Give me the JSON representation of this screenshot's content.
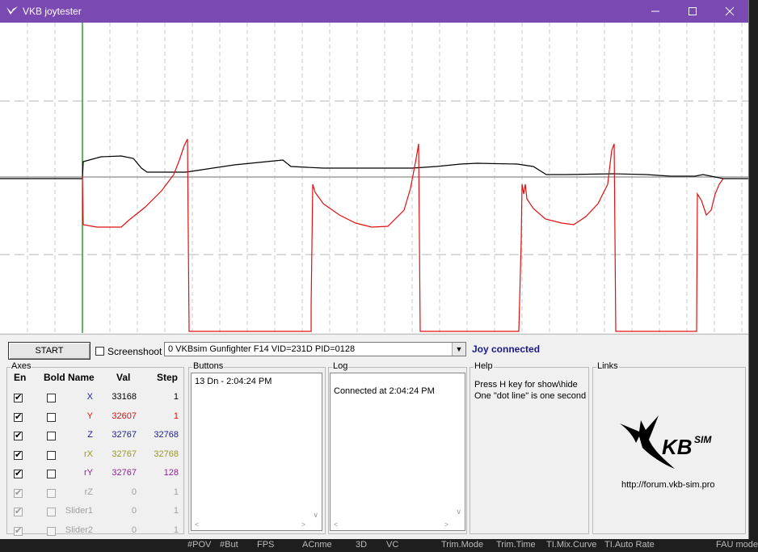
{
  "window": {
    "title": "VKB joytester"
  },
  "toolbar": {
    "start_label": "START",
    "screenshot_label": "Screenshoot",
    "device_select_value": "0  VKBsim Gunfighter F14  VID=231D PID=0128",
    "joy_status": "Joy connected"
  },
  "axes": {
    "title": "Axes",
    "headers": {
      "en": "En",
      "bold": "Bold",
      "name": "Name",
      "val": "Val",
      "step": "Step"
    },
    "rows": [
      {
        "name": "X",
        "val": "33168",
        "step": "1",
        "color": "#1c1c9a",
        "val_color": "#000000",
        "enabled": true,
        "bold": false,
        "disabled": false
      },
      {
        "name": "Y",
        "val": "32607",
        "step": "1",
        "color": "#e01010",
        "val_color": "#e01010",
        "enabled": true,
        "bold": false,
        "disabled": false
      },
      {
        "name": "Z",
        "val": "32767",
        "step": "32768",
        "color": "#1c1c9a",
        "val_color": "#1c1c9a",
        "enabled": true,
        "bold": false,
        "disabled": false
      },
      {
        "name": "rX",
        "val": "32767",
        "step": "32768",
        "color": "#9a9a1a",
        "val_color": "#9a9a1a",
        "enabled": true,
        "bold": false,
        "disabled": false
      },
      {
        "name": "rY",
        "val": "32767",
        "step": "128",
        "color": "#9a1a9a",
        "val_color": "#9a1a9a",
        "enabled": true,
        "bold": false,
        "disabled": false
      },
      {
        "name": "rZ",
        "val": "0",
        "step": "1",
        "color": "#a0a0a0",
        "val_color": "#a0a0a0",
        "enabled": true,
        "bold": false,
        "disabled": true
      },
      {
        "name": "Slider1",
        "val": "0",
        "step": "1",
        "color": "#a0a0a0",
        "val_color": "#a0a0a0",
        "enabled": true,
        "bold": false,
        "disabled": true
      },
      {
        "name": "Slider2",
        "val": "0",
        "step": "1",
        "color": "#a0a0a0",
        "val_color": "#a0a0a0",
        "enabled": true,
        "bold": false,
        "disabled": true
      }
    ]
  },
  "buttons_group": {
    "title": "Buttons",
    "items": [
      "13 Dn - 2:04:24 PM"
    ]
  },
  "log_group": {
    "title": "Log",
    "items": [
      "Connected at 2:04:24 PM"
    ]
  },
  "help_group": {
    "title": "Help",
    "lines": [
      "Press H key for show\\hide",
      "One \"dot line\" is one second"
    ]
  },
  "links_group": {
    "title": "Links",
    "logo_text": "VKBsim",
    "url": "http://forum.vkb-sim.pro"
  },
  "taskbar": {
    "items": [
      "#POV",
      "#But",
      "FPS",
      "ACnme",
      "3D",
      "VC",
      "Trim.Mode",
      "Trim.Time",
      "TI.Mix.Curve",
      "TI.Auto Rate",
      "FAU mode"
    ]
  },
  "colors": {
    "title_bar": "#7a4ab2",
    "trace_x": "#000000",
    "trace_y": "#e01010",
    "cursor": "#008000"
  }
}
